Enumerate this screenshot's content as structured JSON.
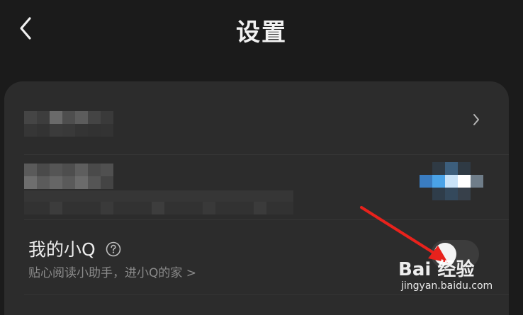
{
  "header": {
    "title": "设置",
    "back_icon": "chevron-left-icon"
  },
  "settings": {
    "account_row": {
      "content": "pixelated",
      "trailing_icon": "chevron-right-icon"
    },
    "profile_row": {
      "content": "pixelated"
    },
    "xiaoq_row": {
      "title": "我的小Q",
      "subtitle": "贴心阅读小助手，进小Q的家 >",
      "help_icon": "question-circle-icon",
      "toggle_state": "on"
    }
  },
  "overlay": {
    "arrow_color": "#e8221c",
    "watermark_logo": "Bai 经验",
    "watermark_url": "jingyan.baidu.com"
  },
  "colors": {
    "background": "#1b1b1b",
    "card": "#2c2c2c",
    "accent_blue": "#4aa3e8"
  }
}
